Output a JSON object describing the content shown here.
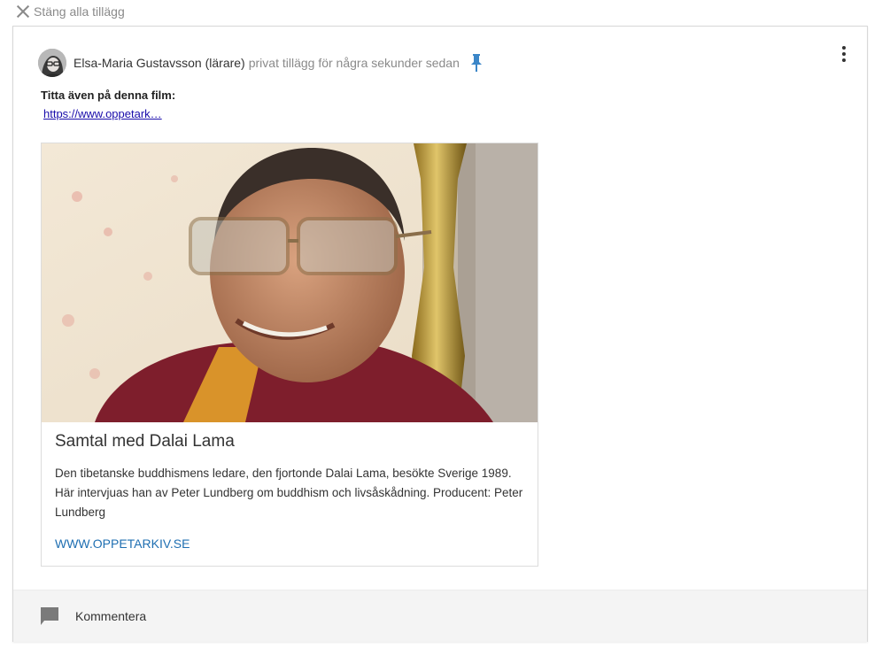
{
  "topbar": {
    "close_label": "Stäng alla tillägg"
  },
  "post": {
    "author": "Elsa-Maria Gustavsson (lärare)",
    "privacy_time": "privat tillägg för några sekunder sedan",
    "title": "Titta även på denna film:",
    "link_text": "https://www.oppetark…",
    "avatar_icon": "user-avatar",
    "pin_icon": "pin-icon",
    "menu_icon": "kebab-menu-icon"
  },
  "embed": {
    "title": "Samtal med Dalai Lama",
    "description": "Den tibetanske buddhismens ledare, den fjortonde Dalai Lama, besökte Sverige 1989. Här intervjuas han av Peter Lundberg om buddhism och livsåskådning. Producent: Peter Lundberg",
    "domain": "WWW.OPPETARKIV.SE",
    "thumbnail_icon": "video-thumbnail"
  },
  "footer": {
    "comment_label": "Kommentera",
    "comment_icon": "comment-icon"
  },
  "colors": {
    "link": "#1a0dab",
    "domain": "#1f6fb2",
    "pin": "#3b86c8",
    "muted": "#8a8a8a"
  }
}
